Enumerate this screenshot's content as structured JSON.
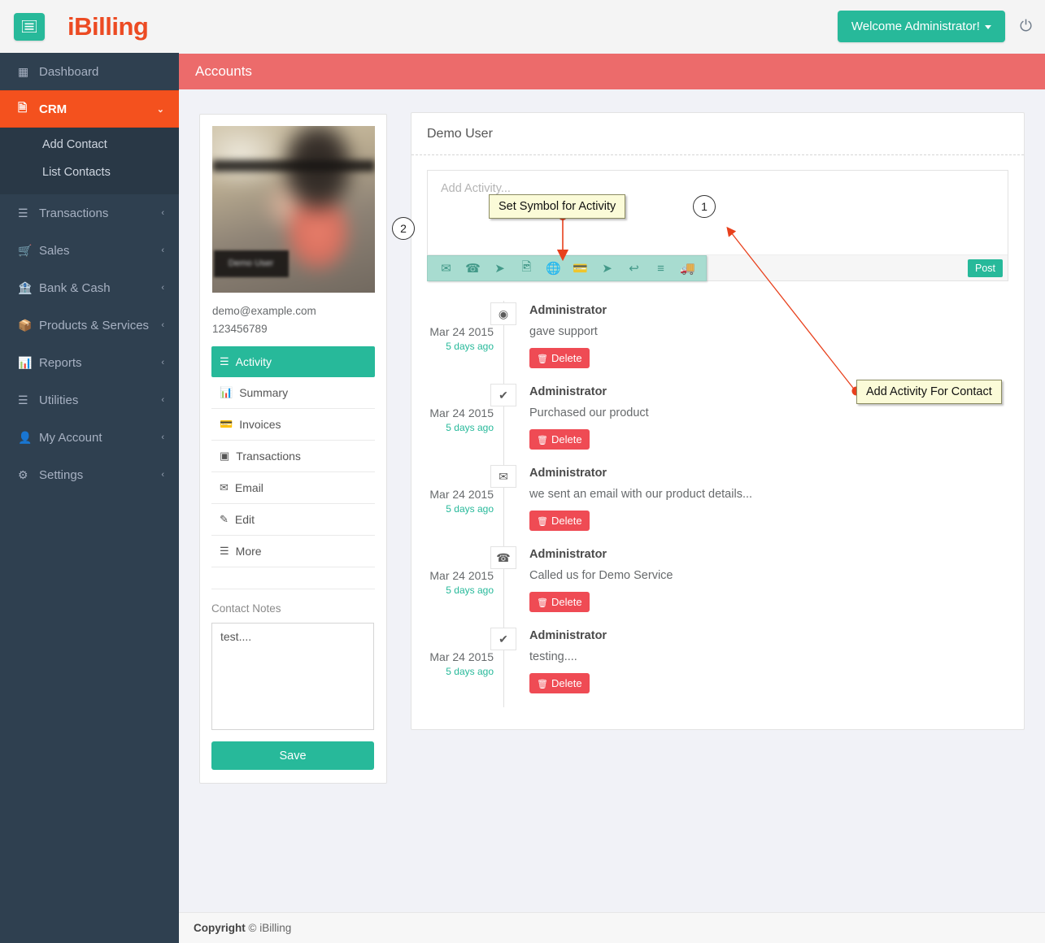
{
  "topbar": {
    "menu_toggle_icon": "list-icon",
    "brand": "iBilling",
    "welcome_label": "Welcome Administrator!",
    "power_icon": "power-icon"
  },
  "sidebar": {
    "items": [
      {
        "label": "Dashboard",
        "icon": "grid-icon",
        "active": false,
        "chevron": ""
      },
      {
        "label": "CRM",
        "icon": "book-icon",
        "active": true,
        "chevron": "⌄"
      },
      {
        "label": "Transactions",
        "icon": "database-icon",
        "active": false,
        "chevron": "‹"
      },
      {
        "label": "Sales",
        "icon": "cart-icon",
        "active": false,
        "chevron": "‹"
      },
      {
        "label": "Bank & Cash",
        "icon": "bank-icon",
        "active": false,
        "chevron": "‹"
      },
      {
        "label": "Products & Services",
        "icon": "box-icon",
        "active": false,
        "chevron": "‹"
      },
      {
        "label": "Reports",
        "icon": "bar-chart-icon",
        "active": false,
        "chevron": "‹"
      },
      {
        "label": "Utilities",
        "icon": "bars-icon",
        "active": false,
        "chevron": "‹"
      },
      {
        "label": "My Account",
        "icon": "user-icon",
        "active": false,
        "chevron": "‹"
      },
      {
        "label": "Settings",
        "icon": "gears-icon",
        "active": false,
        "chevron": "‹"
      }
    ],
    "crm_submenu": [
      {
        "label": "Add Contact"
      },
      {
        "label": "List Contacts"
      }
    ]
  },
  "page": {
    "title": "Accounts"
  },
  "profile": {
    "avatar_caption": "Demo User",
    "email": "demo@example.com",
    "phone": "123456789",
    "menu": [
      {
        "label": "Activity",
        "icon": "activity-icon",
        "active": true
      },
      {
        "label": "Summary",
        "icon": "chart-icon",
        "active": false
      },
      {
        "label": "Invoices",
        "icon": "card-icon",
        "active": false
      },
      {
        "label": "Transactions",
        "icon": "list-alt-icon",
        "active": false
      },
      {
        "label": "Email",
        "icon": "envelope-icon",
        "active": false
      },
      {
        "label": "Edit",
        "icon": "pencil-icon",
        "active": false
      },
      {
        "label": "More",
        "icon": "bars-icon",
        "active": false
      }
    ],
    "notes_label": "Contact Notes",
    "notes_value": "test....",
    "notes_placeholder": "",
    "save_label": "Save"
  },
  "activity_panel": {
    "title": "Demo User",
    "compose_placeholder": "Add Activity...",
    "compose_value": "",
    "post_label": "Post",
    "symbols": [
      {
        "name": "envelope-icon",
        "glyph": "✉"
      },
      {
        "name": "phone-icon",
        "glyph": "☎"
      },
      {
        "name": "paper-plane-icon",
        "glyph": "➤"
      },
      {
        "name": "file-image-icon",
        "glyph": "Ὓb"
      },
      {
        "name": "globe-icon",
        "glyph": "ἱ0"
      },
      {
        "name": "credit-card-icon",
        "glyph": "▭"
      },
      {
        "name": "location-arrow-icon",
        "glyph": "➤"
      },
      {
        "name": "reply-icon",
        "glyph": "↩"
      },
      {
        "name": "align-left-icon",
        "glyph": "≡"
      },
      {
        "name": "truck-icon",
        "glyph": "Ὡa"
      }
    ],
    "feed": [
      {
        "date": "Mar 24 2015",
        "ago": "5 days ago",
        "icon": "life-ring-icon",
        "glyph": "☉",
        "author": "Administrator",
        "text": "gave support",
        "delete_label": "Delete"
      },
      {
        "date": "Mar 24 2015",
        "ago": "5 days ago",
        "icon": "check-icon",
        "glyph": "✔",
        "author": "Administrator",
        "text": "Purchased our product",
        "delete_label": "Delete"
      },
      {
        "date": "Mar 24 2015",
        "ago": "5 days ago",
        "icon": "envelope-icon",
        "glyph": "✉",
        "author": "Administrator",
        "text": "we sent an email with our product details...",
        "delete_label": "Delete"
      },
      {
        "date": "Mar 24 2015",
        "ago": "5 days ago",
        "icon": "phone-icon",
        "glyph": "☎",
        "author": "Administrator",
        "text": "Called us for Demo Service",
        "delete_label": "Delete"
      },
      {
        "date": "Mar 24 2015",
        "ago": "5 days ago",
        "icon": "check-icon",
        "glyph": "✔",
        "author": "Administrator",
        "text": "testing....",
        "delete_label": "Delete"
      }
    ]
  },
  "annotations": {
    "badge_1": "1",
    "badge_2": "2",
    "callout_symbol": "Set Symbol for Activity",
    "callout_add_activity": "Add Activity For Contact"
  },
  "footer": {
    "copyright_bold": "Copyright",
    "copyright_rest": " © iBilling"
  },
  "colors": {
    "brand_orange": "#ec4b23",
    "teal": "#27b99a",
    "sidebar": "#2f4050",
    "active_nav": "#f4511e",
    "page_head": "#ec6b6b",
    "danger": "#ef4b54"
  }
}
